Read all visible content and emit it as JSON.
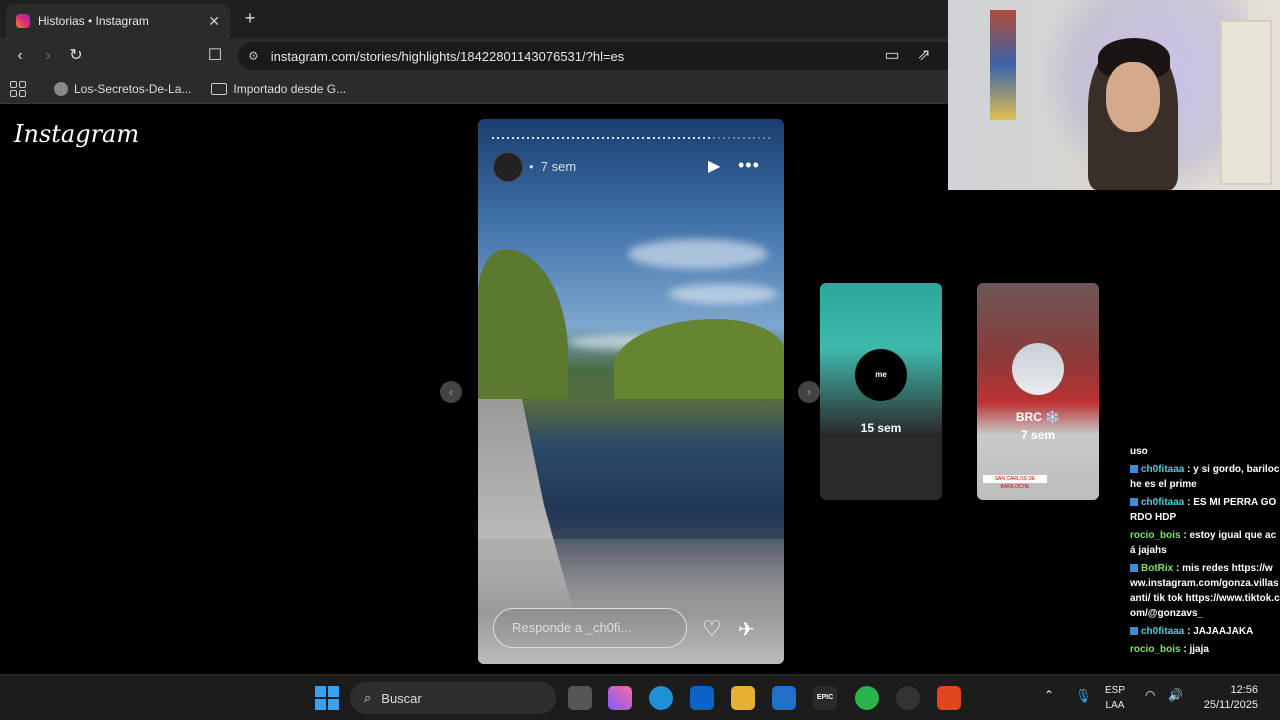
{
  "browser": {
    "tab_title": "Historias • Instagram",
    "tab_close": "✕",
    "new_tab": "+",
    "url": "instagram.com/stories/highlights/18422801143076531/?hl=es",
    "bookmarks": [
      "Los-Secretos-De-La...",
      "Importado desde G..."
    ]
  },
  "page": {
    "logo": "Instagram",
    "story": {
      "time": "7 sem",
      "separator": "•",
      "reply_placeholder": "Responde a _ch0fi..."
    },
    "cards": [
      {
        "avatar_label": "me",
        "time": "15 sem"
      },
      {
        "name": "BRC ❄️",
        "time": "7 sem",
        "badge": "SAN CARLOS DE BARILOCHE"
      }
    ]
  },
  "chat": {
    "messages": [
      {
        "user": "",
        "text": "uso"
      },
      {
        "user": "ch0fitaaa",
        "text": "y si gordo, bariloche es el prime"
      },
      {
        "user": "ch0fitaaa",
        "text": "ES MI PERRA GORDO HDP"
      },
      {
        "user": "rocio_bois",
        "text": "estoy igual que acá jajahs"
      },
      {
        "user": "BotRix",
        "text": "mis redes https://www.instagram.com/gonza.villasanti/ tik tok https://www.tiktok.com/@gonzavs_"
      },
      {
        "user": "ch0fitaaa",
        "text": "JAJAAJAKA"
      },
      {
        "user": "rocio_bois",
        "text": "jjaja"
      }
    ]
  },
  "taskbar": {
    "search": "Buscar",
    "lang_1": "ESP",
    "lang_2": "LAA",
    "time": "12:56",
    "date": "25/11/2025"
  }
}
